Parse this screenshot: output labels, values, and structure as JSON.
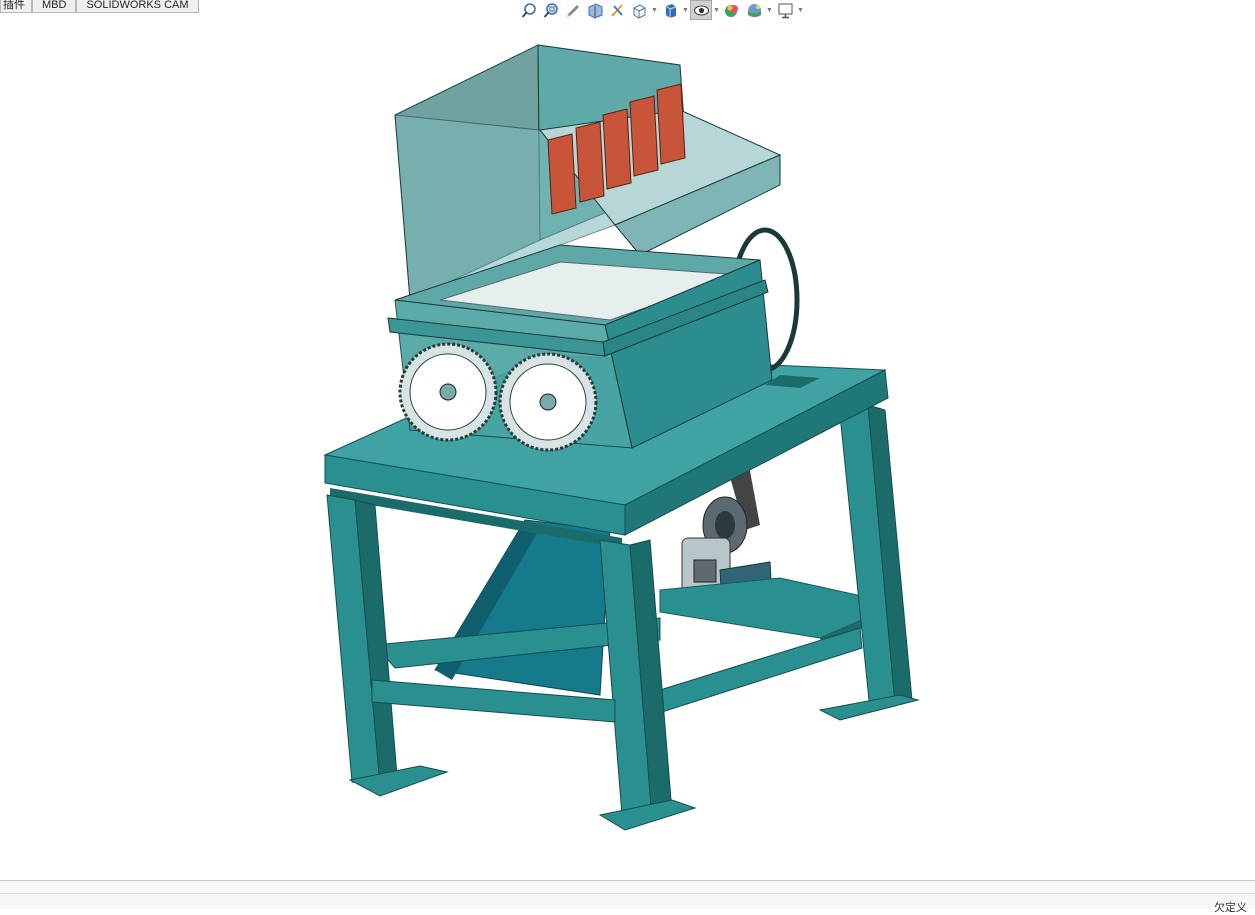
{
  "tabs": [
    {
      "label": "插件"
    },
    {
      "label": "MBD"
    },
    {
      "label": "SOLIDWORKS CAM"
    }
  ],
  "toolbar": {
    "icons": [
      "zoom-to-fit-icon",
      "zoom-to-area-icon",
      "previous-view-icon",
      "section-view-icon",
      "dynamic-annotation-icon",
      "view-orientation-icon",
      "display-style-icon",
      "hide-show-items-icon",
      "edit-appearance-icon",
      "apply-scene-icon",
      "view-settings-icon"
    ]
  },
  "model": {
    "name": "shredder-assembly",
    "colors": {
      "frame": "#2a8f8f",
      "frame_dark": "#1c6b6b",
      "housing": "#3a9a9a",
      "hopper": "#6fb5b5",
      "flaps": "#c8553a",
      "chute": "#157a8c",
      "gear": "#d8e4e4"
    }
  },
  "status": {
    "text": "欠定义"
  }
}
